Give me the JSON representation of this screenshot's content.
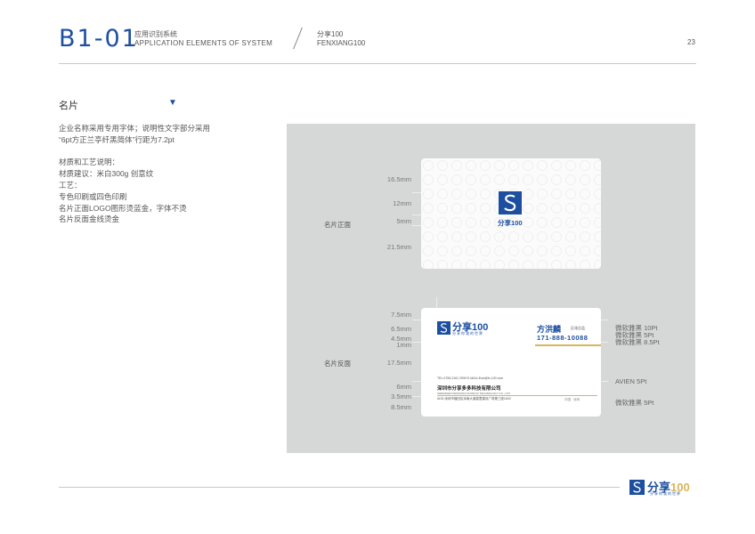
{
  "header": {
    "code": "B1-01",
    "system_cn": "应用识别系统",
    "system_en": "APPLICATION ELEMENTS OF SYSTEM",
    "brand_cn": "分享100",
    "brand_en": "FENXIANG100",
    "page_number": "23"
  },
  "section": {
    "title": "名片",
    "arrow": "▼",
    "description": [
      "企业名称采用专用字体；说明性文字部分采用",
      "“6pt方正兰亭纤黑简体”行距为7.2pt",
      "",
      "材质和工艺说明：",
      "材质建议：米白300g 创意纹",
      "工艺：",
      "专色印刷或四色印刷",
      "名片正面LOGO图形烫蓝金，字体不烫",
      "名片反面金线烫金"
    ]
  },
  "front": {
    "label": "名片正面",
    "logo_text": "分享100",
    "dims": [
      "16.5mm",
      "12mm",
      "5mm",
      "21.5mm"
    ]
  },
  "back": {
    "label": "名片反面",
    "logo_text": "分享100",
    "slogan": "分享你我的世界",
    "name": "方洪麟",
    "title": "区域总监",
    "phone": "171-888-10088",
    "tel_line": "TEL:0755-2161 2999      E-MAIL:4hot@fx-100.com",
    "company": "深圳市分享多多科技有限公司",
    "company_en": "SHENZHEN FENXIANG DUODUO TECHNOLOGY CO., LTD",
    "address": "ADD:深圳市福田区深南大道嘉里建设广场第三座1602",
    "location": "中国 · 深圳",
    "dims": [
      "7.5mm",
      "6.5mm",
      "4.5mm",
      "1mm",
      "17.5mm",
      "6mm",
      "3.5mm",
      "8.5mm"
    ],
    "specs": [
      "微软雅黑 10Pt",
      "微软雅黑 5Pt",
      "微软雅黑 8.5Pt",
      "AVIEN 5Pt",
      "微软雅黑 5Pt"
    ]
  },
  "footer": {
    "logo_cn": "分享",
    "logo_num": "100",
    "slogan": "分享你我的世界"
  },
  "colors": {
    "brand_blue": "#1d4fa0",
    "gold": "#d7b65a",
    "panel_gray": "#d6d7d7"
  }
}
